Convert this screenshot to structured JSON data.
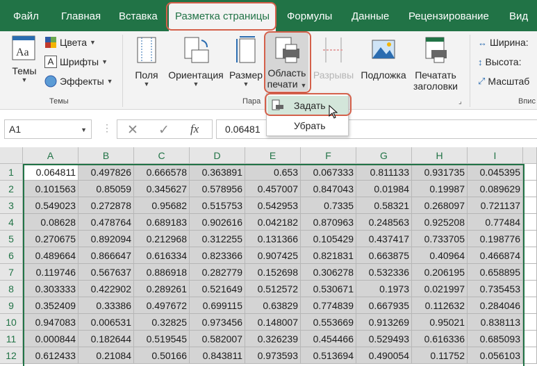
{
  "tabs": [
    "Файл",
    "Главная",
    "Вставка",
    "Разметка страницы",
    "Формулы",
    "Данные",
    "Рецензирование",
    "Вид"
  ],
  "ribbon": {
    "themes": {
      "button_label": "Темы",
      "group_label": "Темы",
      "colors": "Цвета",
      "fonts": "Шрифты",
      "effects": "Эффекты"
    },
    "page_setup": {
      "margins": "Поля",
      "orientation": "Ориентация",
      "size": "Размер",
      "print_area_line1": "Область",
      "print_area_line2": "печати",
      "breaks": "Разрывы",
      "background": "Подложка",
      "print_titles_line1": "Печатать",
      "print_titles_line2": "заголовки",
      "group_label": "Пара"
    },
    "scale": {
      "width": "Ширина:",
      "height": "Высота:",
      "scale": "Масштаб",
      "group_label": "Впис"
    }
  },
  "dropdown": {
    "set": "Задать",
    "clear": "Убрать"
  },
  "formula_bar": {
    "name_box": "A1",
    "fx": "fx",
    "value": "0.06481"
  },
  "colors": {
    "brand": "#217346",
    "callout": "#d4604a"
  },
  "sheet": {
    "columns": [
      "A",
      "B",
      "C",
      "D",
      "E",
      "F",
      "G",
      "H",
      "I"
    ],
    "rows": [
      [
        "0.064811",
        "0.497826",
        "0.666578",
        "0.363891",
        "0.653",
        "0.067333",
        "0.811133",
        "0.931735",
        "0.045395"
      ],
      [
        "0.101563",
        "0.85059",
        "0.345627",
        "0.578956",
        "0.457007",
        "0.847043",
        "0.01984",
        "0.19987",
        "0.089629"
      ],
      [
        "0.549023",
        "0.272878",
        "0.95682",
        "0.515753",
        "0.542953",
        "0.7335",
        "0.58321",
        "0.268097",
        "0.721137"
      ],
      [
        "0.08628",
        "0.478764",
        "0.689183",
        "0.902616",
        "0.042182",
        "0.870963",
        "0.248563",
        "0.925208",
        "0.77484"
      ],
      [
        "0.270675",
        "0.892094",
        "0.212968",
        "0.312255",
        "0.131366",
        "0.105429",
        "0.437417",
        "0.733705",
        "0.198776"
      ],
      [
        "0.489664",
        "0.866647",
        "0.616334",
        "0.823366",
        "0.907425",
        "0.821831",
        "0.663875",
        "0.40964",
        "0.466874"
      ],
      [
        "0.119746",
        "0.567637",
        "0.886918",
        "0.282779",
        "0.152698",
        "0.306278",
        "0.532336",
        "0.206195",
        "0.658895"
      ],
      [
        "0.303333",
        "0.422902",
        "0.289261",
        "0.521649",
        "0.512572",
        "0.530671",
        "0.1973",
        "0.021997",
        "0.735453"
      ],
      [
        "0.352409",
        "0.33386",
        "0.497672",
        "0.699115",
        "0.63829",
        "0.774839",
        "0.667935",
        "0.112632",
        "0.284046"
      ],
      [
        "0.947083",
        "0.006531",
        "0.32825",
        "0.973456",
        "0.148007",
        "0.553669",
        "0.913269",
        "0.95021",
        "0.838113"
      ],
      [
        "0.000844",
        "0.182644",
        "0.519545",
        "0.582007",
        "0.326239",
        "0.454466",
        "0.529493",
        "0.616336",
        "0.685093"
      ],
      [
        "0.612433",
        "0.21084",
        "0.50166",
        "0.843811",
        "0.973593",
        "0.513694",
        "0.490054",
        "0.11752",
        "0.056103"
      ]
    ]
  }
}
